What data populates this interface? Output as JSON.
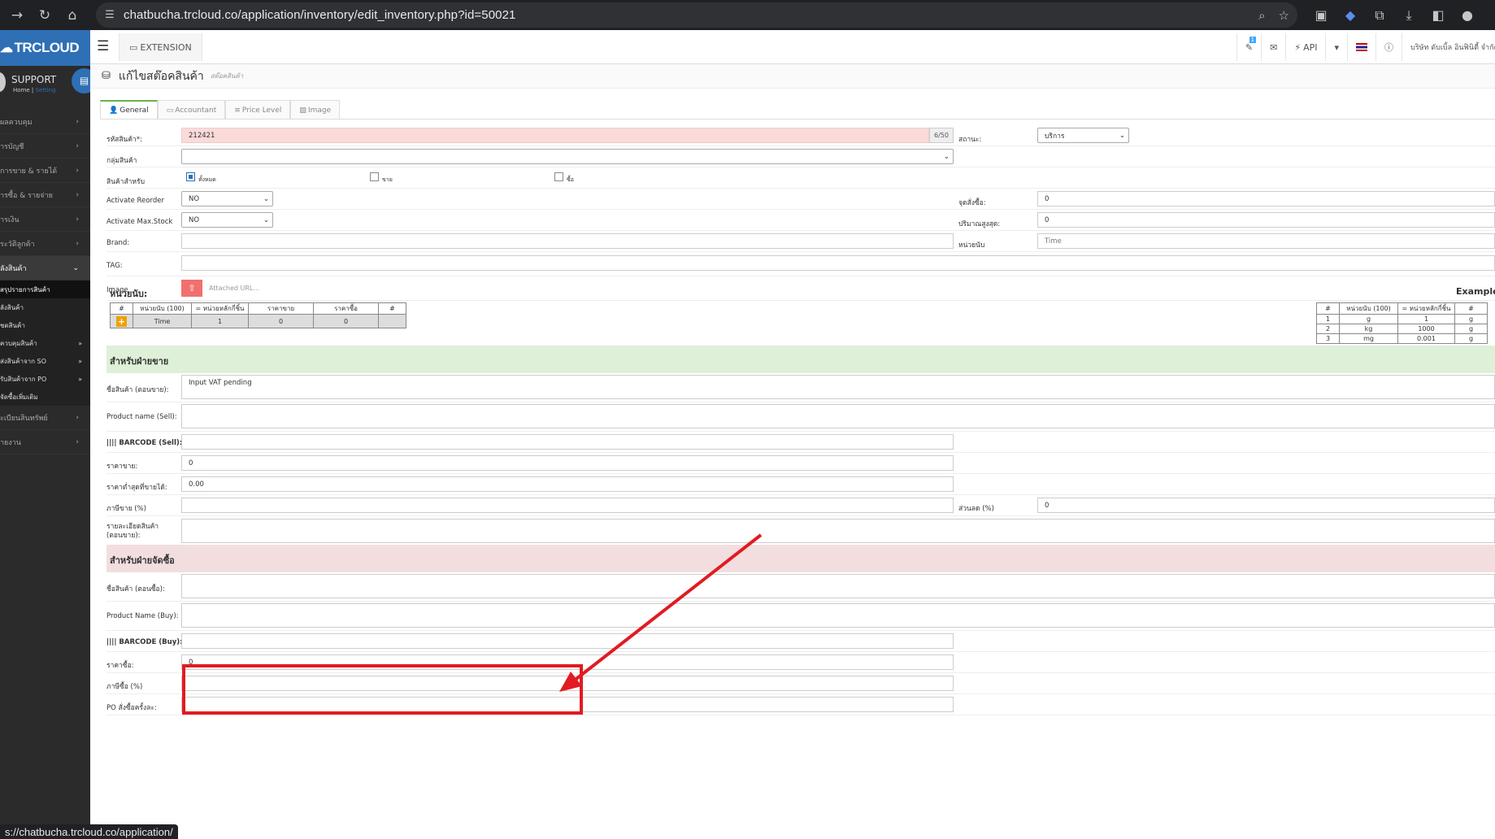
{
  "browser": {
    "url": "chatbucha.trcloud.co/application/inventory/edit_inventory.php?id=50021",
    "status_url": "s://chatbucha.trcloud.co/application/"
  },
  "app": {
    "logo": "TRCLOUD",
    "support_title": "SUPPORT",
    "support_home": "Home",
    "support_setting": "Setting",
    "extension_label": "EXTENSION",
    "api_label": "API",
    "company": "บริษัท ดับเบิ้ล อินฟินิตี้ จำกัด",
    "notify_count": "1"
  },
  "sidebar": {
    "items": [
      {
        "label": "ผลควบคุม"
      },
      {
        "label": "ารบัญชี"
      },
      {
        "label": "การขาย & รายได้"
      },
      {
        "label": "ารซื้อ & รายจ่าย"
      },
      {
        "label": "ารเงิน"
      },
      {
        "label": "ระวัติลูกค้า"
      },
      {
        "label": "ลังสินค้า"
      }
    ],
    "subitems": [
      {
        "label": "สรุปรายการสินค้า"
      },
      {
        "label": "ลังสินค้า"
      },
      {
        "label": "ชดสินค้า"
      },
      {
        "label": "ควบคุมสินค้า"
      },
      {
        "label": "ส่งสินค้าจาก SO"
      },
      {
        "label": "รับสินค้าจาก PO"
      },
      {
        "label": "จัดซื้อเพิ่มเติม"
      }
    ],
    "bottom": [
      {
        "label": "ะเบียนสินทรัพย์"
      },
      {
        "label": "ายงาน"
      }
    ]
  },
  "page": {
    "title": "แก้ไขสต๊อคสินค้า",
    "subtitle": "สต๊อคสินค้า"
  },
  "tabs": [
    "General",
    "Accountant",
    "Price Level",
    "Image"
  ],
  "form": {
    "code_label": "รหัสสินค้า*:",
    "code_value": "212421",
    "code_counter": "6/50",
    "status_label": "สถานะ:",
    "status_value": "บริการ",
    "group_label": "กลุ่มสินค้า",
    "for_label": "สินค้าสำหรับ",
    "for_all": "ทั้งหมด",
    "for_sell": "ขาย",
    "for_buy": "ซื้อ",
    "reorder_label": "Activate Reorder",
    "reorder_value": "NO",
    "reorder_point_label": "จุดสั่งซื้อ:",
    "reorder_point_value": "0",
    "maxstock_label": "Activate Max.Stock",
    "maxstock_value": "NO",
    "max_qty_label": "ปริมาณสูงสุด:",
    "max_qty_value": "0",
    "brand_label": "Brand:",
    "unit_label": "หน่วยนับ",
    "unit_placeholder": "Time",
    "tag_label": "TAG:",
    "image_label": "Image",
    "image_placeholder": "Attached URL..."
  },
  "units": {
    "heading": "หน่วยนับ:",
    "headers": [
      "#",
      "หน่วยนับ (100)",
      "= หน่วยหลักกี่ชิ้น",
      "ราคาขาย",
      "ราคาซื้อ",
      "#"
    ],
    "row": [
      "Time",
      "1",
      "0",
      "0"
    ]
  },
  "example": {
    "heading": "Example",
    "headers": [
      "#",
      "หน่วยนับ (100)",
      "= หน่วยหลักกี่ชิ้น",
      "#"
    ],
    "rows": [
      [
        "1",
        "g",
        "1",
        "g"
      ],
      [
        "2",
        "kg",
        "1000",
        "g"
      ],
      [
        "3",
        "mg",
        "0.001",
        "g"
      ]
    ]
  },
  "sell": {
    "heading": "สำหรับฝ่ายขาย",
    "name_label": "ชื่อสินค้า (ตอนขาย):",
    "name_value": "Input VAT pending",
    "pname_label": "Product name (Sell):",
    "barcode_label": "BARCODE (Sell):",
    "price_label": "ราคาขาย:",
    "price_value": "0",
    "min_label": "ราคาต่ำสุดที่ขายได้:",
    "min_value": "0.00",
    "tax_label": "ภาษีขาย (%)",
    "discount_label": "ส่วนลด (%)",
    "discount_value": "0",
    "desc_label": "รายละเอียดสินค้า (ตอนขาย):"
  },
  "buy": {
    "heading": "สำหรับฝ่ายจัดซื้อ",
    "name_label": "ชื่อสินค้า (ตอนซื้อ):",
    "pname_label": "Product Name (Buy):",
    "barcode_label": "BARCODE (Buy):",
    "price_label": "ราคาซื้อ:",
    "price_value": "0",
    "tax_label": "ภาษีซื้อ (%)",
    "po_label": "PO สั่งซื้อครั้งละ:"
  },
  "colors": {
    "accent": "#2f6fb5",
    "annotation": "#e11b22"
  }
}
